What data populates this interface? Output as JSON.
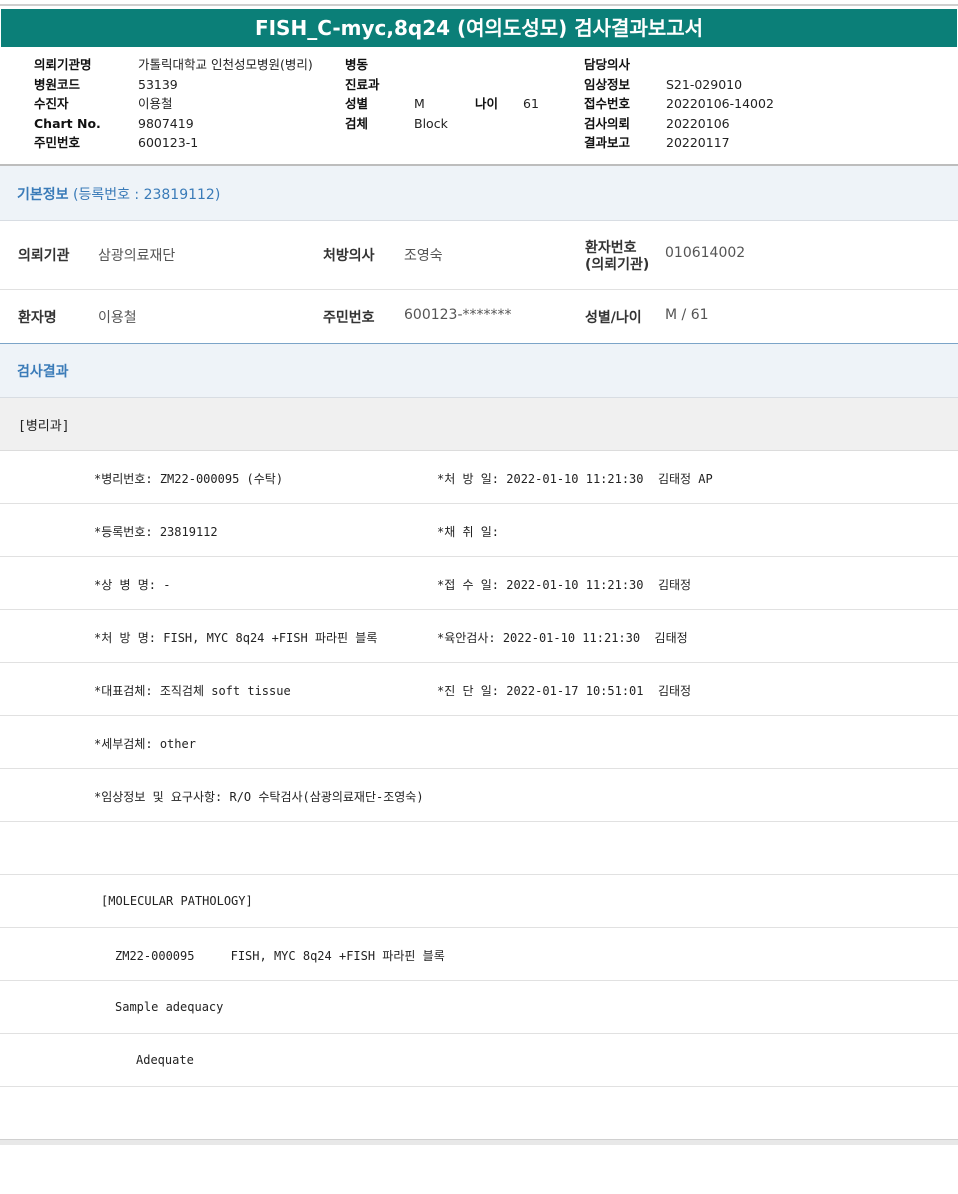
{
  "title": "FISH_C-myc,8q24 (여의도성모) 검사결과보고서",
  "header": {
    "col1": [
      {
        "label": "의뢰기관명",
        "value": "가톨릭대학교 인천성모병원(병리)"
      },
      {
        "label": "병원코드",
        "value": "53139"
      },
      {
        "label": "수진자",
        "value": "이용철"
      },
      {
        "label": "Chart No.",
        "value": "9807419"
      },
      {
        "label": "주민번호",
        "value": "600123-1"
      }
    ],
    "col2": [
      {
        "label": "병동",
        "value": ""
      },
      {
        "label": "진료과",
        "value": ""
      },
      {
        "label": "성별",
        "value": "M"
      },
      {
        "label": "검체",
        "value": "Block"
      }
    ],
    "age_label": "나이",
    "age_value": "61",
    "col3": [
      {
        "label": "담당의사",
        "value": ""
      },
      {
        "label": "임상정보",
        "value": "S21-029010"
      },
      {
        "label": "접수번호",
        "value": "20220106-14002"
      },
      {
        "label": "검사의뢰",
        "value": "20220106"
      },
      {
        "label": "결과보고",
        "value": "20220117"
      }
    ]
  },
  "basic": {
    "title": "기본정보",
    "reg": "(등록번호 : 23819112)",
    "row1": {
      "l1": "의뢰기관",
      "v1": "삼광의료재단",
      "l2": "처방의사",
      "v2": "조영숙",
      "l3a": "환자번호",
      "l3b": "(의뢰기관)",
      "v3": "010614002"
    },
    "row2": {
      "l1": "환자명",
      "v1": "이용철",
      "l2": "주민번호",
      "v2": "600123-*******",
      "l3": "성별/나이",
      "v3": "M / 61"
    }
  },
  "result": {
    "title": "검사결과",
    "dept": "[병리과]",
    "rows": [
      {
        "left": "*병리번호: ZM22-000095 (수탁)",
        "right": "*처 방 일: 2022-01-10 11:21:30  김태정 AP"
      },
      {
        "left": "*등록번호: 23819112",
        "right": "*채 취 일:"
      },
      {
        "left": "*상 병 명: -",
        "right": "*접 수 일: 2022-01-10 11:21:30  김태정"
      },
      {
        "left": "*처 방 명: FISH, MYC 8q24 +FISH 파라핀 블록",
        "right": "*육안검사: 2022-01-10 11:21:30  김태정"
      },
      {
        "left": "*대표검체: 조직검체 soft tissue",
        "right": "*진 단 일: 2022-01-17 10:51:01  김태정"
      },
      {
        "left": "*세부검체: other",
        "right": ""
      },
      {
        "left": "*임상정보 및 요구사항: R/O 수탁검사(삼광의료재단-조영숙)",
        "right": ""
      },
      {
        "left": "",
        "right": ""
      }
    ],
    "molecular": [
      {
        "text": "[MOLECULAR PATHOLOGY]",
        "indent": 1
      },
      {
        "text": "ZM22-000095     FISH, MYC 8q24 +FISH 파라핀 블록",
        "indent": 2
      },
      {
        "text": "Sample adequacy",
        "indent": 2
      },
      {
        "text": "Adequate",
        "indent": 3
      }
    ]
  }
}
